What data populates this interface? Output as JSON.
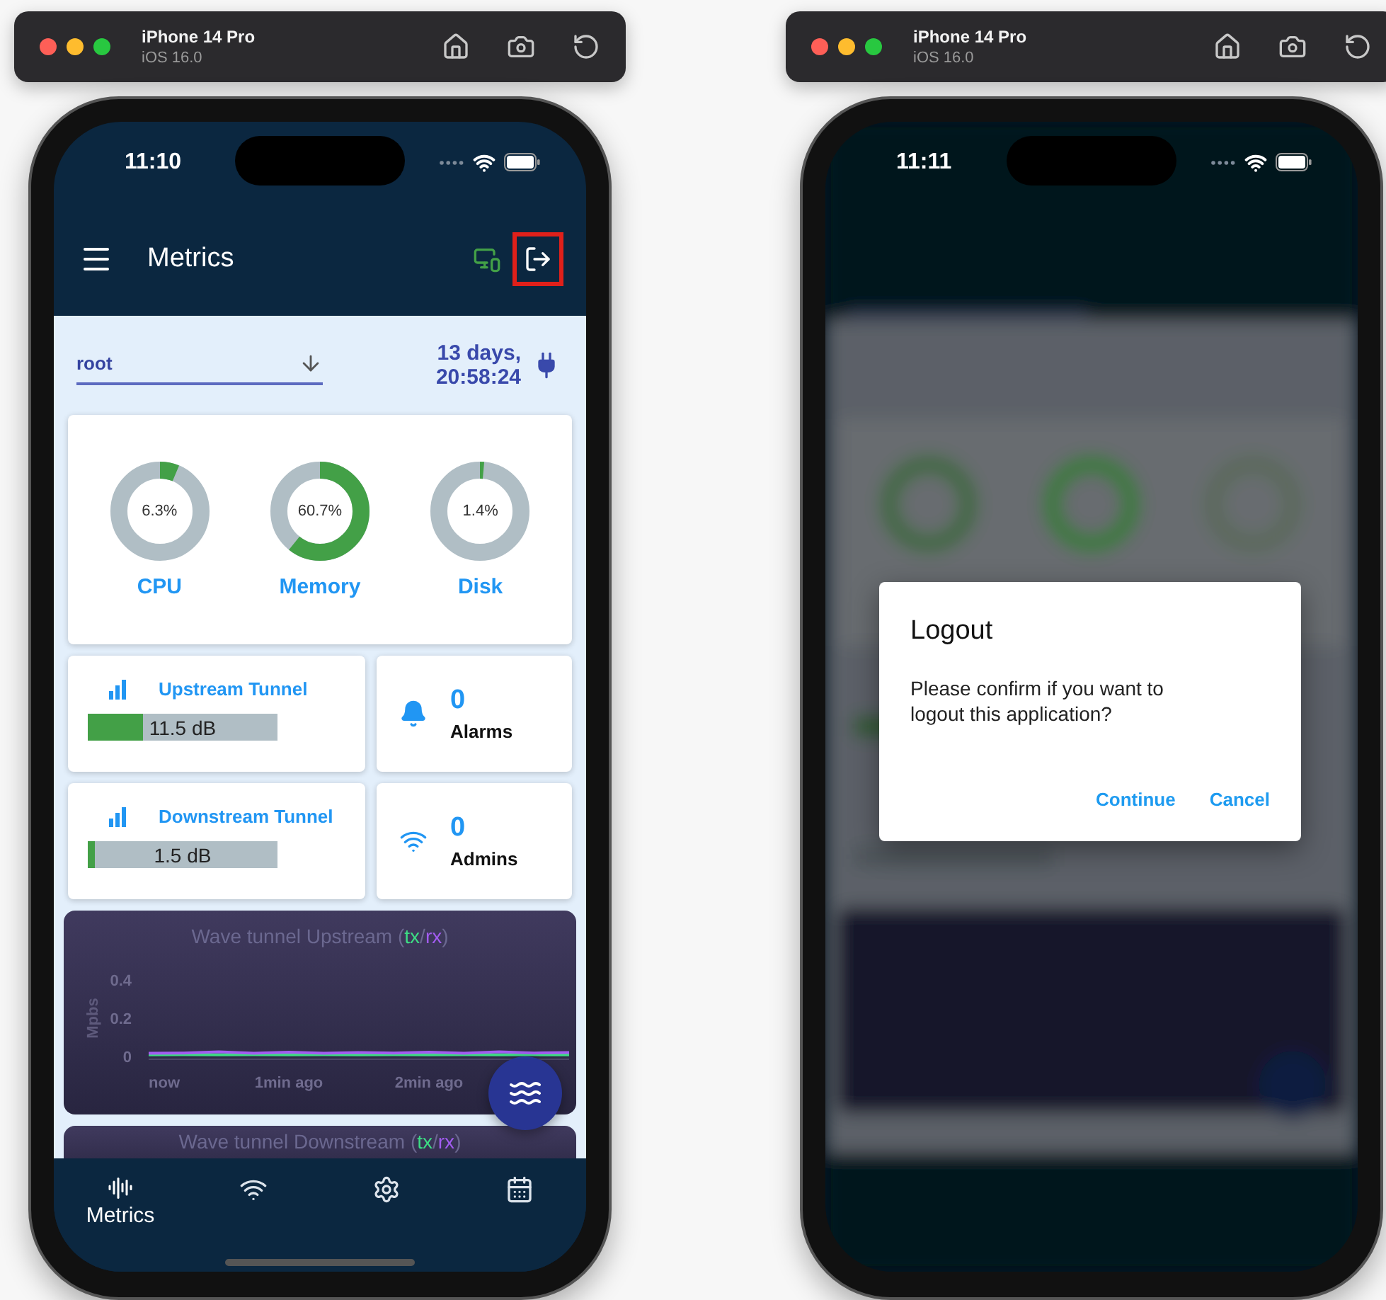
{
  "simulators": [
    {
      "kind": "app",
      "device": "iPhone 14 Pro",
      "os": "iOS 16.0",
      "status_time": "11:10",
      "app_bar": {
        "title": "Metrics",
        "actions": [
          {
            "kind": "device",
            "highlighted": false
          },
          {
            "kind": "logout",
            "highlighted": true
          }
        ]
      },
      "user_select": {
        "value": "root"
      },
      "uptime": [
        "13 days,",
        "20:58:24"
      ],
      "gauges": [
        {
          "value": "6.3%",
          "label": "CPU",
          "level": 0.063
        },
        {
          "value": "60.7%",
          "label": "Memory",
          "level": 0.607
        },
        {
          "value": "1.4%",
          "label": "Disk",
          "level": 0.014
        }
      ],
      "tunnels": [
        {
          "title": "Upstream Tunnel",
          "reading": "11.5 dB",
          "level": 0.29
        },
        {
          "title": "Downstream Tunnel",
          "reading": "1.5 dB",
          "level": 0.04
        }
      ],
      "counters": [
        {
          "kind": "alarms",
          "count": "0",
          "label": "Alarms"
        },
        {
          "kind": "admins",
          "count": "0",
          "label": "Admins"
        }
      ],
      "charts": [
        {
          "title": "Wave tunnel Upstream",
          "legend_open": "(",
          "legend_separator": "/",
          "legend_close": ")",
          "chart_data": {
            "type": "line",
            "ylabel": "Mpbs",
            "ylim": [
              0,
              0.4
            ],
            "yticks": [
              0,
              0.2,
              0.4
            ],
            "xlim": [
              0,
              3
            ],
            "xticks": [
              {
                "value": 0,
                "label": "now"
              },
              {
                "value": 1,
                "label": "1min ago"
              },
              {
                "value": 2,
                "label": "2min ago"
              }
            ],
            "x": [
              0,
              0.25,
              0.5,
              0.75,
              1,
              1.25,
              1.5,
              1.75,
              2,
              2.25,
              2.5,
              2.75,
              3
            ],
            "series": [
              {
                "name": "tx",
                "color": "#3ddc84",
                "values": [
                  0.008,
                  0.009,
                  0.008,
                  0.009,
                  0.008,
                  0.009,
                  0.008,
                  0.009,
                  0.008,
                  0.009,
                  0.008,
                  0.009,
                  0.008
                ]
              },
              {
                "name": "rx",
                "color": "#a25cf0",
                "values": [
                  0.016,
                  0.018,
                  0.024,
                  0.016,
                  0.022,
                  0.016,
                  0.02,
                  0.018,
                  0.022,
                  0.016,
                  0.024,
                  0.018,
                  0.02
                ]
              }
            ]
          }
        },
        {
          "title": "Wave tunnel Downstream",
          "legend_open": "(",
          "legend_separator": "/",
          "legend_close": ")",
          "legend": [
            {
              "name": "tx",
              "color": "#3ddc84"
            },
            {
              "name": "rx",
              "color": "#a25cf0"
            }
          ]
        }
      ],
      "nav": [
        {
          "kind": "metrics",
          "label": "Metrics",
          "selected": true
        },
        {
          "kind": "network",
          "selected": false
        },
        {
          "kind": "settings",
          "selected": false
        },
        {
          "kind": "calendar",
          "selected": false
        }
      ]
    },
    {
      "kind": "dialog",
      "device": "iPhone 14 Pro",
      "os": "iOS 16.0",
      "status_time": "11:11",
      "dialog": {
        "title": "Logout",
        "message": "Please confirm if you want to logout this application?",
        "actions": [
          "Continue",
          "Cancel"
        ]
      }
    }
  ]
}
